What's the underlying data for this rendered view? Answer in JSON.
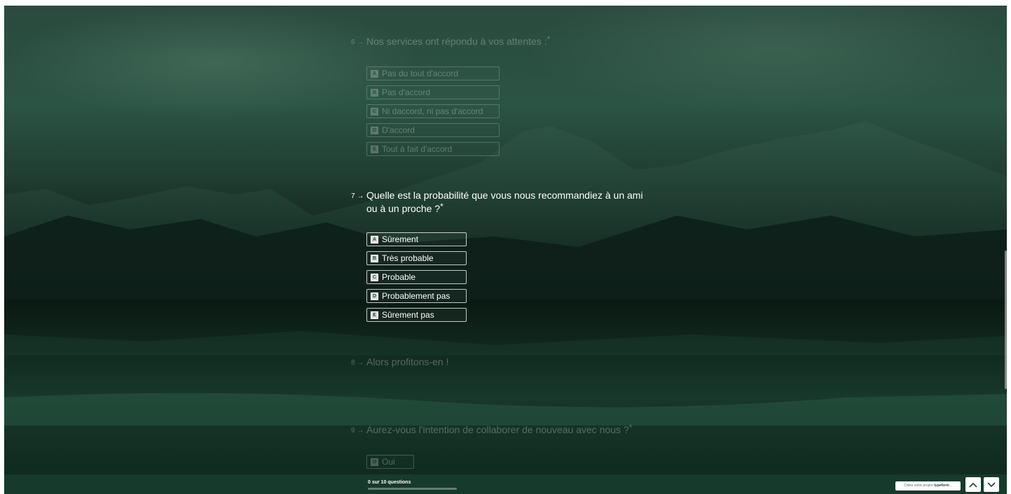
{
  "questions": [
    {
      "number": "6",
      "arrow": "→",
      "text": "Nos services ont répondu à vos attentes :",
      "required_mark": "*",
      "choices": [
        {
          "key": "A",
          "label": "Pas du tout d'accord"
        },
        {
          "key": "B",
          "label": "Pas d'accord"
        },
        {
          "key": "C",
          "label": "Ni daccord, ni pas d'accord"
        },
        {
          "key": "D",
          "label": "D'accord"
        },
        {
          "key": "E",
          "label": "Tout à fait d'accord"
        }
      ]
    },
    {
      "number": "7",
      "arrow": "→",
      "text_line1": "Quelle est la probabilité que vous nous recommandiez à un ami",
      "text_line2": "ou à un proche ?",
      "required_mark": "*",
      "choices": [
        {
          "key": "A",
          "label": "Sûrement"
        },
        {
          "key": "B",
          "label": "Très probable"
        },
        {
          "key": "C",
          "label": "Probable"
        },
        {
          "key": "D",
          "label": "Probablement pas"
        },
        {
          "key": "E",
          "label": "Sûrement pas"
        }
      ]
    },
    {
      "number": "8",
      "arrow": "→",
      "text": "Alors profitons-en !"
    },
    {
      "number": "9",
      "arrow": "→",
      "text": "Aurez-vous l'intention de collaborer de nouveau avec nous ?",
      "required_mark": "*",
      "choices": [
        {
          "key": "O",
          "label": "Oui"
        }
      ]
    }
  ],
  "footer": {
    "progress_text": "0 sur 10 questions",
    "progress_fraction": 0.0,
    "brand_prefix": "Créez votre propre ",
    "brand_name": "typeform",
    "brand_suffix": "...",
    "nav_up_icon": "chevron-up-icon",
    "nav_down_icon": "chevron-down-icon"
  },
  "colors": {
    "theme_green": "#1f4a3a",
    "footer_bg": "#163a2b",
    "text": "#ffffff"
  }
}
